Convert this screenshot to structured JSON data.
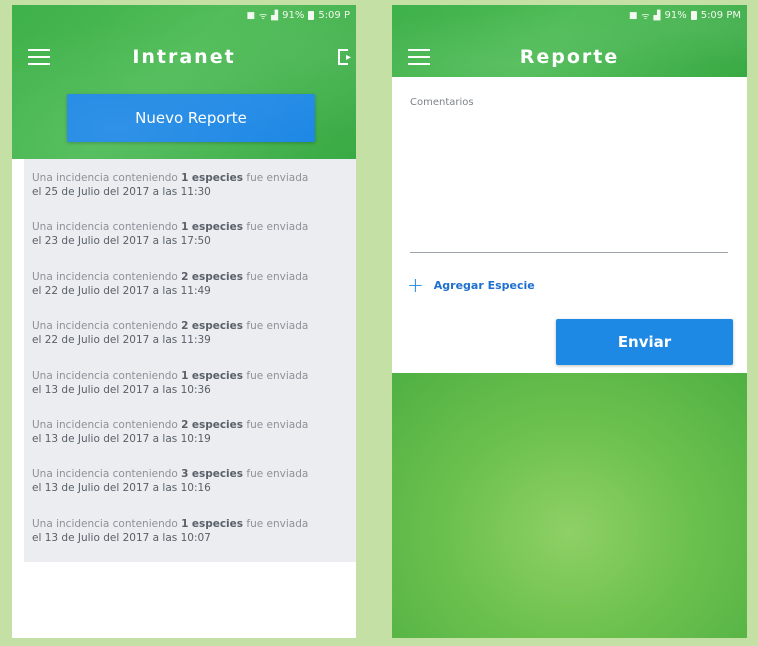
{
  "left": {
    "status": {
      "time": "5:09 P",
      "battery": "91%"
    },
    "title": "Intranet",
    "new_report_label": "Nuevo Reporte",
    "items": [
      {
        "pre": "Una incidencia conteniendo ",
        "num": "1",
        "word": "especies",
        "post": " fue enviada",
        "line2": "el 25 de Julio del 2017 a las 11:30"
      },
      {
        "pre": "Una incidencia conteniendo ",
        "num": "1",
        "word": "especies",
        "post": " fue enviada",
        "line2": "el 23 de Julio del 2017 a las 17:50"
      },
      {
        "pre": "Una incidencia conteniendo ",
        "num": "2",
        "word": "especies",
        "post": " fue enviada",
        "line2": "el 22 de Julio del 2017 a las 11:49"
      },
      {
        "pre": "Una incidencia conteniendo ",
        "num": "2",
        "word": "especies",
        "post": " fue enviada",
        "line2": "el 22 de Julio del 2017 a las 11:39"
      },
      {
        "pre": "Una incidencia conteniendo ",
        "num": "1",
        "word": "especies",
        "post": " fue enviada",
        "line2": "el 13 de Julio del 2017 a las 10:36"
      },
      {
        "pre": "Una incidencia conteniendo ",
        "num": "2",
        "word": "especies",
        "post": " fue enviada",
        "line2": "el 13 de Julio del 2017 a las 10:19"
      },
      {
        "pre": "Una incidencia conteniendo ",
        "num": "3",
        "word": "especies",
        "post": " fue enviada",
        "line2": "el 13 de Julio del 2017 a las 10:16"
      },
      {
        "pre": "Una incidencia conteniendo ",
        "num": "1",
        "word": "especies",
        "post": " fue enviada",
        "line2": "el 13 de Julio del 2017 a las 10:07"
      }
    ]
  },
  "right": {
    "status": {
      "time": "5:09 PM",
      "battery": "91%"
    },
    "title": "Reporte",
    "comments_label": "Comentarios",
    "comments_value": "",
    "add_species_label": "Agregar Especie",
    "send_label": "Enviar"
  },
  "colors": {
    "green": "#3fb14a",
    "blue": "#1e88e5",
    "frame": "#c5e0a5"
  }
}
